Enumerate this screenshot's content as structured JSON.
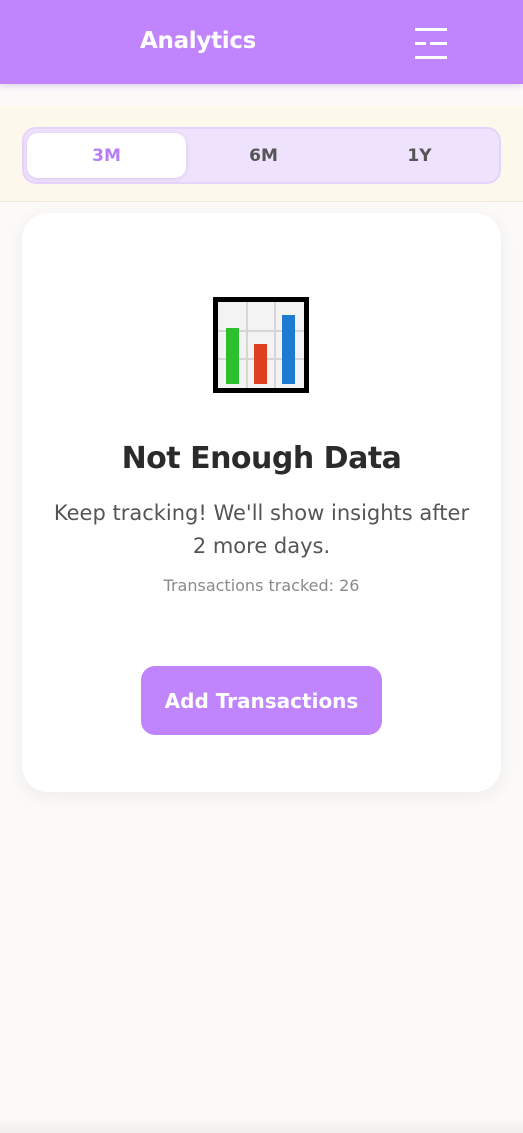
{
  "header": {
    "title": "Analytics",
    "menu_icon": "menu-icon",
    "background_color": "#c084fc"
  },
  "range": {
    "tabs": [
      {
        "label": "3M",
        "active": true
      },
      {
        "label": "6M",
        "active": false
      },
      {
        "label": "1Y",
        "active": false
      }
    ],
    "active_color": "#b77ef5"
  },
  "empty_state": {
    "icon": "bar-chart-icon",
    "title": "Not Enough Data",
    "message": "Keep tracking! We'll show insights after 2 more days.",
    "tracked_text": "Transactions tracked: 26",
    "button_label": "Add Transactions",
    "button_color": "#c084fc"
  }
}
